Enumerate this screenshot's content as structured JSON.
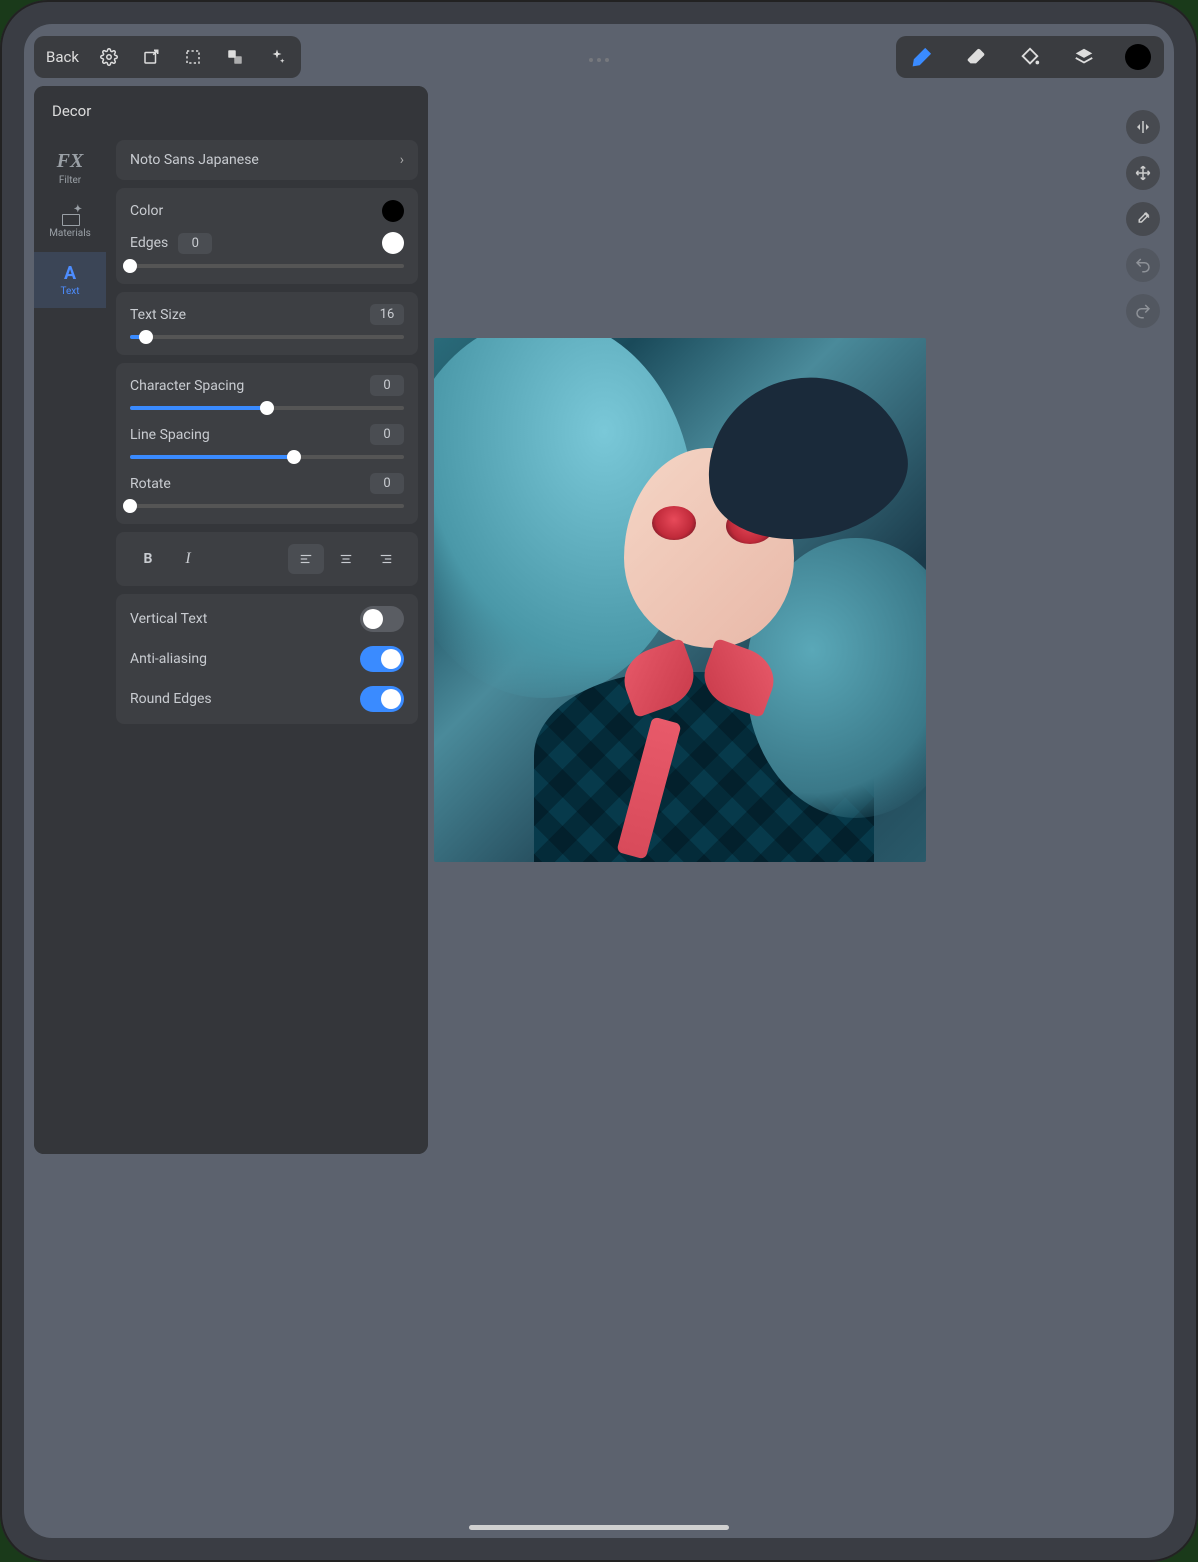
{
  "toolbar_left": {
    "back": "Back"
  },
  "toolbar_right": {
    "swatch_color": "#000000"
  },
  "panel": {
    "title": "Decor",
    "tabs": {
      "filter": {
        "icon": "FX",
        "label": "Filter"
      },
      "materials": {
        "label": "Materials"
      },
      "text": {
        "icon": "A",
        "label": "Text"
      }
    },
    "font": {
      "name": "Noto Sans Japanese"
    },
    "color": {
      "label": "Color",
      "hex": "#000000"
    },
    "edges": {
      "label": "Edges",
      "value": "0",
      "percent": 0,
      "swatch_hex": "#ffffff"
    },
    "text_size": {
      "label": "Text Size",
      "value": "16",
      "percent": 6
    },
    "char_spacing": {
      "label": "Character Spacing",
      "value": "0",
      "percent": 50
    },
    "line_spacing": {
      "label": "Line Spacing",
      "value": "0",
      "percent": 60
    },
    "rotate": {
      "label": "Rotate",
      "value": "0",
      "percent": 0
    },
    "format": {
      "bold": "B",
      "italic": "I"
    },
    "vertical_text": {
      "label": "Vertical Text",
      "on": false
    },
    "anti_aliasing": {
      "label": "Anti-aliasing",
      "on": true
    },
    "round_edges": {
      "label": "Round Edges",
      "on": true
    }
  }
}
